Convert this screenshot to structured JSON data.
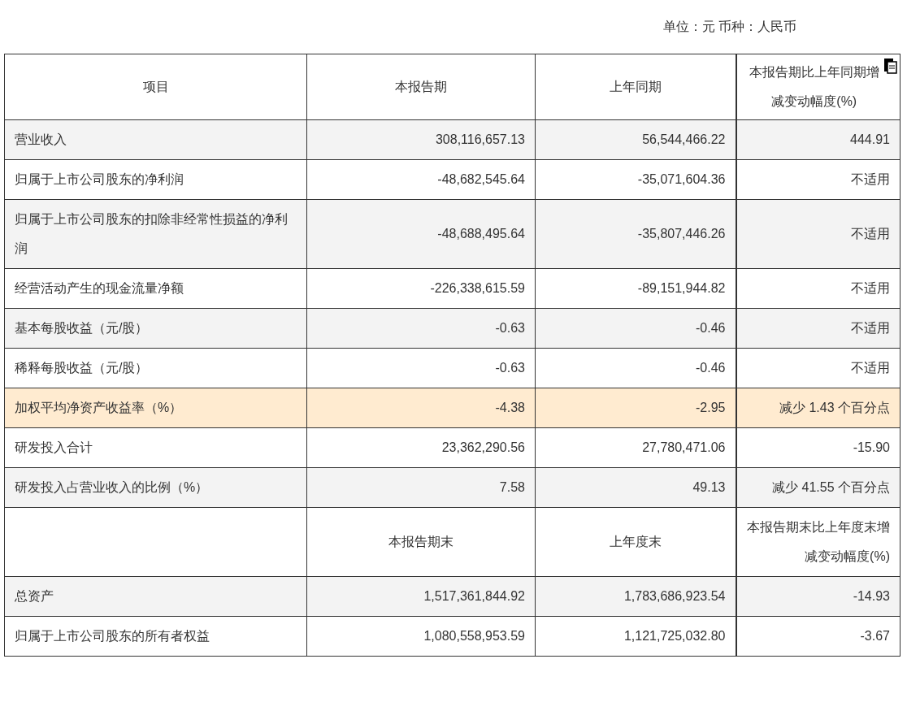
{
  "unit_note": "单位：元 币种：人民币",
  "table": {
    "columns": [
      "项目",
      "本报告期",
      "上年同期",
      "本报告期比上年同期增减变动幅度(%)"
    ],
    "rows": [
      {
        "kind": "data",
        "highlighted": false,
        "cells": [
          "营业收入",
          "308,116,657.13",
          "56,544,466.22",
          "444.91"
        ]
      },
      {
        "kind": "data",
        "highlighted": false,
        "cells": [
          "归属于上市公司股东的净利润",
          "-48,682,545.64",
          "-35,071,604.36",
          "不适用"
        ]
      },
      {
        "kind": "data",
        "highlighted": false,
        "cells": [
          "归属于上市公司股东的扣除非经常性损益的净利润",
          "-48,688,495.64",
          "-35,807,446.26",
          "不适用"
        ]
      },
      {
        "kind": "data",
        "highlighted": false,
        "cells": [
          "经营活动产生的现金流量净额",
          "-226,338,615.59",
          "-89,151,944.82",
          "不适用"
        ]
      },
      {
        "kind": "data",
        "highlighted": false,
        "cells": [
          "基本每股收益（元/股）",
          "-0.63",
          "-0.46",
          "不适用"
        ]
      },
      {
        "kind": "data",
        "highlighted": false,
        "cells": [
          "稀释每股收益（元/股）",
          "-0.63",
          "-0.46",
          "不适用"
        ]
      },
      {
        "kind": "data",
        "highlighted": true,
        "cells": [
          "加权平均净资产收益率（%）",
          "-4.38",
          "-2.95",
          "减少 1.43 个百分点"
        ]
      },
      {
        "kind": "data",
        "highlighted": false,
        "cells": [
          "研发投入合计",
          "23,362,290.56",
          "27,780,471.06",
          "-15.90"
        ]
      },
      {
        "kind": "data",
        "highlighted": false,
        "cells": [
          "研发投入占营业收入的比例（%）",
          "7.58",
          "49.13",
          "减少 41.55 个百分点"
        ]
      },
      {
        "kind": "subheader",
        "highlighted": false,
        "cells": [
          "",
          "本报告期末",
          "上年度末",
          "本报告期末比上年度末增减变动幅度(%)"
        ]
      },
      {
        "kind": "data",
        "highlighted": false,
        "cells": [
          "总资产",
          "1,517,361,844.92",
          "1,783,686,923.54",
          "-14.93"
        ]
      },
      {
        "kind": "data",
        "highlighted": false,
        "cells": [
          "归属于上市公司股东的所有者权益",
          "1,080,558,953.59",
          "1,121,725,032.80",
          "-3.67"
        ]
      }
    ]
  }
}
